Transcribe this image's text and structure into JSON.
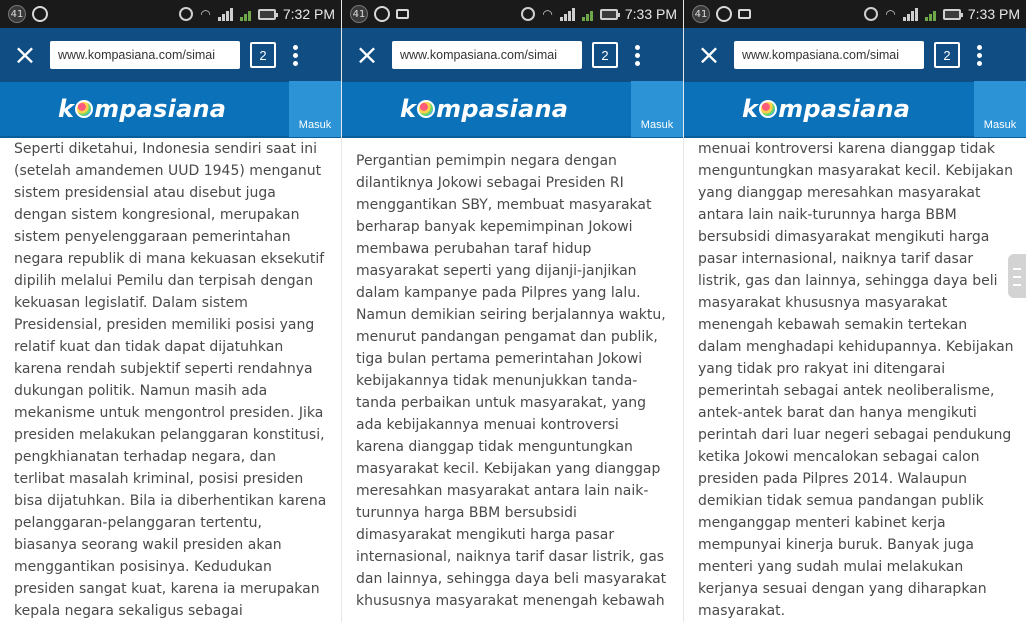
{
  "status": [
    {
      "notif_count": "41",
      "time": "7:32 PM"
    },
    {
      "notif_count": "41",
      "time": "7:33 PM"
    },
    {
      "notif_count": "41",
      "time": "7:33 PM"
    }
  ],
  "browser": {
    "close_label": "×",
    "url_text": "www.kompasiana.com/simai",
    "tabs_count": "2"
  },
  "site": {
    "logo_left": "k",
    "logo_right": "mpasiana",
    "login_label": "Masuk"
  },
  "articles": [
    {
      "text": "Seperti diketahui, Indonesia sendiri saat ini (setelah amandemen UUD 1945) menganut sistem presidensial atau disebut juga dengan sistem kongresional, merupakan sistem penyelenggaraan pemerintahan negara republik di mana kekuasan eksekutif dipilih melalui Pemilu dan terpisah dengan kekuasan legislatif. Dalam sistem Presidensial, presiden memiliki posisi yang relatif kuat dan tidak dapat dijatuhkan karena rendah subjektif seperti rendahnya dukungan politik. Namun masih ada mekanisme untuk mengontrol presiden. Jika presiden melakukan pelanggaran konstitusi, pengkhianatan terhadap negara, dan terlibat masalah kriminal, posisi presiden bisa dijatuhkan. Bila ia diberhentikan karena pelanggaran-pelanggaran tertentu, biasanya seorang wakil presiden akan menggantikan posisinya. Kedudukan presiden sangat kuat, karena ia merupakan kepala negara sekaligus sebagai"
    },
    {
      "text": "Pergantian pemimpin negara dengan dilantiknya Jokowi sebagai Presiden RI menggantikan SBY, membuat masyarakat berharap banyak kepemimpinan Jokowi membawa perubahan taraf hidup masyarakat seperti yang dijanji-janjikan dalam kampanye pada Pilpres yang lalu. Namun demikian seiring berjalannya waktu, menurut pandangan pengamat dan publik, tiga bulan pertama pemerintahan Jokowi kebijakannya tidak menunjukkan tanda-tanda perbaikan untuk masyarakat, yang ada kebijakannya menuai kontroversi karena dianggap tidak menguntungkan masyarakat kecil. Kebijakan yang dianggap meresahkan masyarakat antara lain  naik-turunnya harga BBM bersubsidi dimasyarakat mengikuti harga pasar internasional, naiknya tarif dasar listrik, gas dan lainnya, sehingga daya beli masyarakat khususnya masyarakat menengah kebawah"
    },
    {
      "text": "menuai kontroversi karena dianggap tidak menguntungkan masyarakat kecil. Kebijakan yang dianggap meresahkan masyarakat antara lain  naik-turunnya harga BBM bersubsidi dimasyarakat mengikuti harga pasar internasional, naiknya tarif dasar listrik, gas dan lainnya, sehingga daya beli masyarakat khususnya masyarakat menengah kebawah  semakin tertekan dalam menghadapi kehidupannya. Kebijakan yang tidak pro rakyat ini ditengarai pemerintah sebagai antek neoliberalisme, antek-antek barat dan hanya mengikuti perintah dari luar negeri sebagai pendukung ketika Jokowi mencalokan sebagai calon presiden pada Pilpres 2014. Walaupun demikian tidak semua pandangan  publik menganggap menteri kabinet kerja mempunyai kinerja buruk. Banyak juga menteri yang sudah mulai melakukan kerjanya sesuai dengan yang diharapkan masyarakat."
    }
  ],
  "colors": {
    "status_bg": "#1a1a1a",
    "chrome_bg": "#0f4d83",
    "site_bar_bg": "#0b72ba",
    "login_bg": "#2b93d6",
    "text": "#4a4a4a"
  }
}
